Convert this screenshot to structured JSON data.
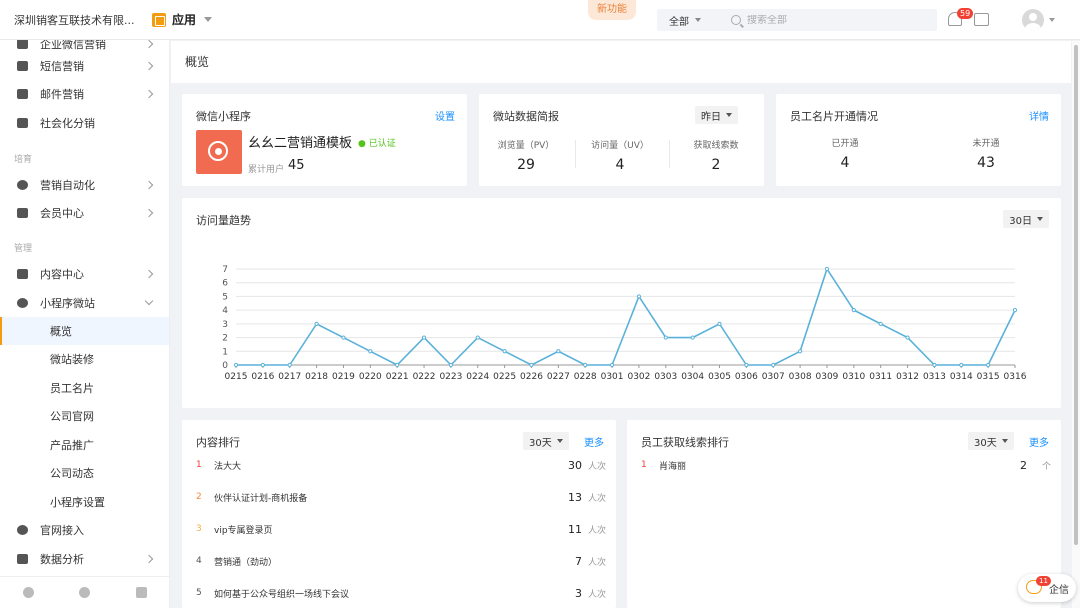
{
  "topbar": {
    "company": "深圳销客互联技术有限...",
    "app_label": "应用",
    "new_feature": "新功能",
    "search_scope": "全部",
    "search_placeholder": "搜索全部",
    "notification_count": "59"
  },
  "sidebar": {
    "items": [
      {
        "label": "企业微信营销",
        "icon": "wechat-work-icon",
        "chevron": true
      },
      {
        "label": "短信营销",
        "icon": "sms-icon",
        "chevron": true
      },
      {
        "label": "邮件营销",
        "icon": "mail-icon",
        "chevron": true
      },
      {
        "label": "社会化分销",
        "icon": "network-icon",
        "chevron": false
      },
      {
        "label": "营销自动化",
        "icon": "automation-icon",
        "chevron": true
      },
      {
        "label": "会员中心",
        "icon": "member-icon",
        "chevron": true
      },
      {
        "label": "内容中心",
        "icon": "content-icon",
        "chevron": true
      },
      {
        "label": "小程序微站",
        "icon": "miniprogram-icon",
        "chevron": true
      },
      {
        "label": "官网接入",
        "icon": "website-icon",
        "chevron": false
      },
      {
        "label": "数据分析",
        "icon": "analytics-icon",
        "chevron": true
      }
    ],
    "groups": [
      "培育",
      "管理"
    ],
    "sub_items": [
      "概览",
      "微站装修",
      "员工名片",
      "公司官网",
      "产品推广",
      "公司动态",
      "小程序设置"
    ]
  },
  "breadcrumb": "概览",
  "mini_program": {
    "title": "微信小程序",
    "settings_link": "设置",
    "template_name": "幺幺二营销通模板",
    "verified": "● 已认证",
    "total_users_label": "累计用户",
    "total_users": "45"
  },
  "site_data": {
    "title": "微站数据简报",
    "period": "昨日",
    "stats": [
      {
        "label": "浏览量（PV）",
        "value": "29"
      },
      {
        "label": "访问量（UV）",
        "value": "4"
      },
      {
        "label": "获取线索数",
        "value": "2"
      }
    ]
  },
  "card_status": {
    "title": "员工名片开通情况",
    "detail_link": "详情",
    "stats": [
      {
        "label": "已开通",
        "value": "4"
      },
      {
        "label": "未开通",
        "value": "43"
      }
    ]
  },
  "trend": {
    "title": "访问量趋势",
    "period": "30日"
  },
  "chart_data": {
    "type": "line",
    "title": "",
    "x": [
      "0215",
      "0216",
      "0217",
      "0218",
      "0219",
      "0220",
      "0221",
      "0222",
      "0223",
      "0224",
      "0225",
      "0226",
      "0227",
      "0228",
      "0301",
      "0302",
      "0303",
      "0304",
      "0305",
      "0306",
      "0307",
      "0308",
      "0309",
      "0310",
      "0311",
      "0312",
      "0313",
      "0314",
      "0315",
      "0316"
    ],
    "values": [
      0,
      0,
      0,
      3,
      2,
      1,
      0,
      2,
      0,
      2,
      1,
      0,
      1,
      0,
      0,
      5,
      2,
      2,
      3,
      0,
      0,
      1,
      7,
      4,
      3,
      2,
      0,
      0,
      0,
      4
    ],
    "ylim": [
      0,
      7
    ],
    "yticks": [
      "0",
      "1",
      "2",
      "3",
      "4",
      "5",
      "6",
      "7"
    ],
    "color": "#5ab1d9",
    "grid": true
  },
  "content_rank": {
    "title": "内容排行",
    "period": "30天",
    "more": "更多",
    "rows": [
      {
        "no": "1",
        "name": "法大大",
        "value": "30",
        "unit": "人次",
        "color": "#f04134"
      },
      {
        "no": "2",
        "name": "伙伴认证计划-商机报备",
        "value": "13",
        "unit": "人次",
        "color": "#f58a3b"
      },
      {
        "no": "3",
        "name": "vip专属登录页",
        "value": "11",
        "unit": "人次",
        "color": "#f5b041"
      },
      {
        "no": "4",
        "name": "营销通（劲动）",
        "value": "7",
        "unit": "人次",
        "color": "#555555"
      },
      {
        "no": "5",
        "name": "如何基于公众号组织一场线下会议",
        "value": "3",
        "unit": "人次",
        "color": "#555555"
      }
    ]
  },
  "lead_rank": {
    "title": "员工获取线索排行",
    "period": "30天",
    "more": "更多",
    "rows": [
      {
        "no": "1",
        "name": "肖海丽",
        "value": "2",
        "unit": "个",
        "color": "#f04134"
      }
    ]
  },
  "chat": {
    "label": "企信",
    "badge": "11"
  }
}
